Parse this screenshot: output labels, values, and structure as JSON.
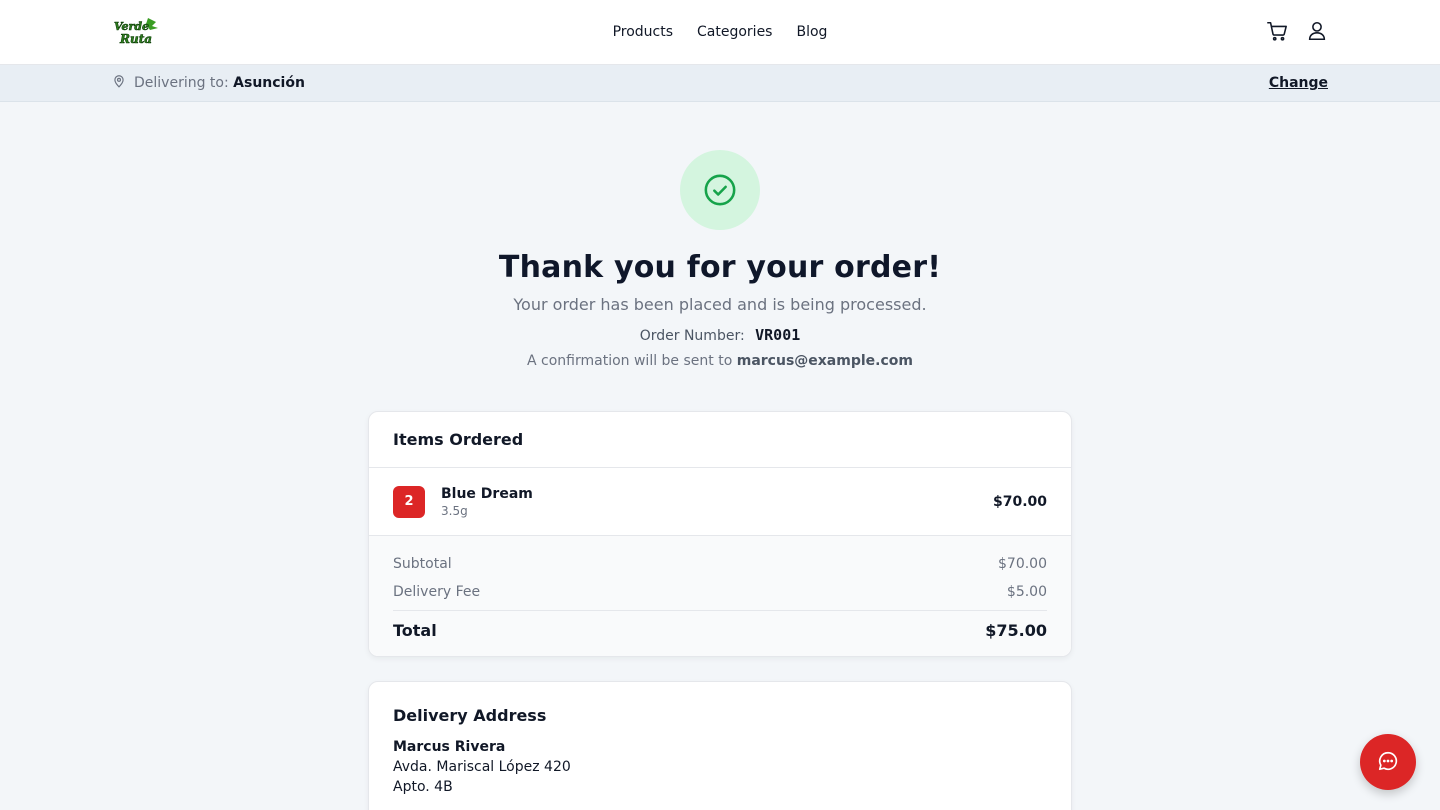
{
  "header": {
    "logo_text": "Verde Ruta",
    "nav": [
      "Products",
      "Categories",
      "Blog"
    ],
    "icons": [
      "cart-icon",
      "user-icon"
    ]
  },
  "delivery": {
    "label": "Delivering to:",
    "city": "Asunción",
    "change": "Change",
    "icon": "location-pin-icon"
  },
  "confirmation": {
    "icon": "check-circle-icon",
    "title": "Thank you for your order!",
    "subtitle": "Your order has been placed and is being processed.",
    "order_label": "Order Number:",
    "order_number": "VR001",
    "confirm_prefix": "A confirmation will be sent to",
    "email": "marcus@example.com"
  },
  "items": {
    "heading": "Items Ordered",
    "list": [
      {
        "qty": "2",
        "name": "Blue Dream",
        "size": "3.5g",
        "price": "$70.00"
      }
    ],
    "subtotal_label": "Subtotal",
    "subtotal": "$70.00",
    "delivery_label": "Delivery Fee",
    "delivery_fee": "$5.00",
    "total_label": "Total",
    "total": "$75.00"
  },
  "address": {
    "heading": "Delivery Address",
    "name": "Marcus Rivera",
    "line1": "Avda. Mariscal López 420",
    "line2": "Apto. 4B"
  },
  "chat": {
    "icon": "chat-bubble-icon"
  },
  "colors": {
    "accent": "#dc2626",
    "success": "#16a34a",
    "success_bg": "#d4f5df",
    "page_bg": "#f3f6f9"
  }
}
